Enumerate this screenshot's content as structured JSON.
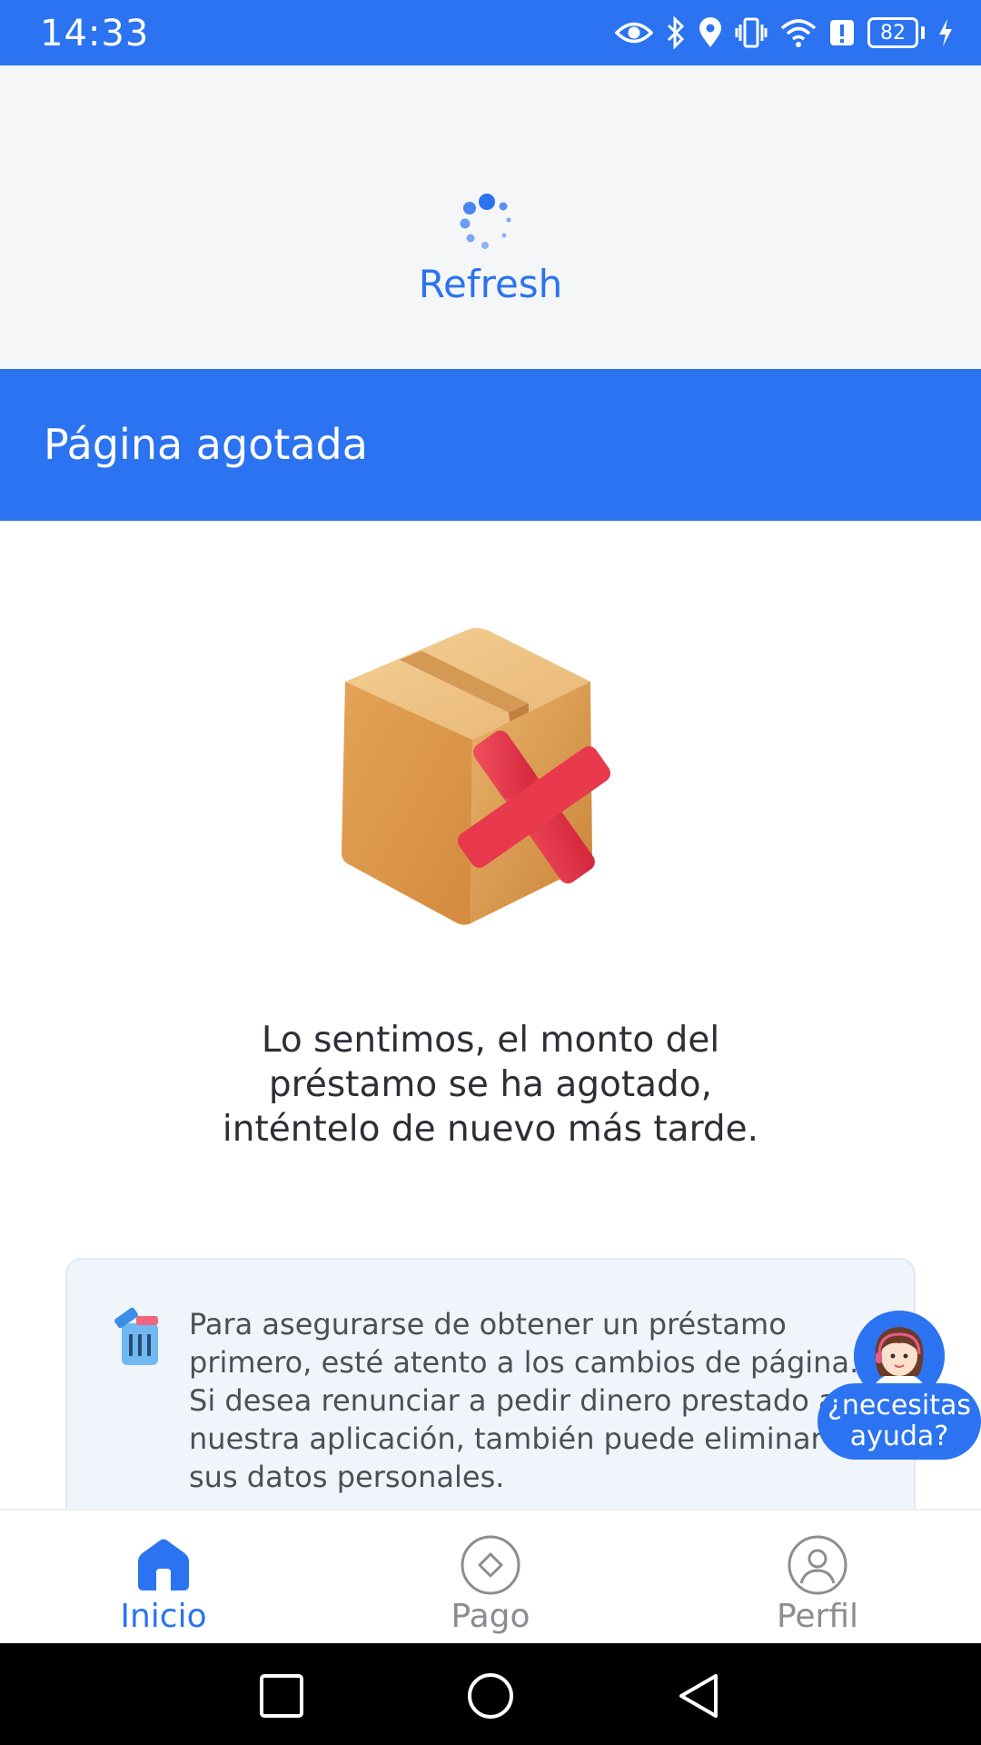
{
  "status_bar": {
    "time": "14:33",
    "battery_level": "82",
    "icons": [
      "eye-icon",
      "bluetooth-icon",
      "location-icon",
      "vibrate-icon",
      "wifi-icon",
      "alert-icon",
      "battery-icon",
      "charging-icon"
    ]
  },
  "refresh": {
    "label": "Refresh"
  },
  "header": {
    "title": "Página agotada"
  },
  "message": {
    "line1": "Lo sentimos, el monto del",
    "line2": "préstamo se ha agotado,",
    "line3": "inténtelo de nuevo más tarde."
  },
  "info_card": {
    "line1": "Para asegurarse de obtener un préstamo",
    "line2": "primero, esté atento a los cambios de página.",
    "line3": "Si desea renunciar a pedir dinero prestado a",
    "line4": "nuestra aplicación, también puede eliminar",
    "line5": "sus datos personales."
  },
  "help": {
    "line1": "¿necesitas",
    "line2": "ayuda?"
  },
  "bottom_nav": {
    "items": [
      {
        "label": "Inicio",
        "icon": "home-icon",
        "active": true
      },
      {
        "label": "Pago",
        "icon": "payment-icon",
        "active": false
      },
      {
        "label": "Perfil",
        "icon": "profile-icon",
        "active": false
      }
    ]
  },
  "colors": {
    "primary": "#2b73f0",
    "inactive": "#8a8d92",
    "text": "#2c2f36"
  }
}
